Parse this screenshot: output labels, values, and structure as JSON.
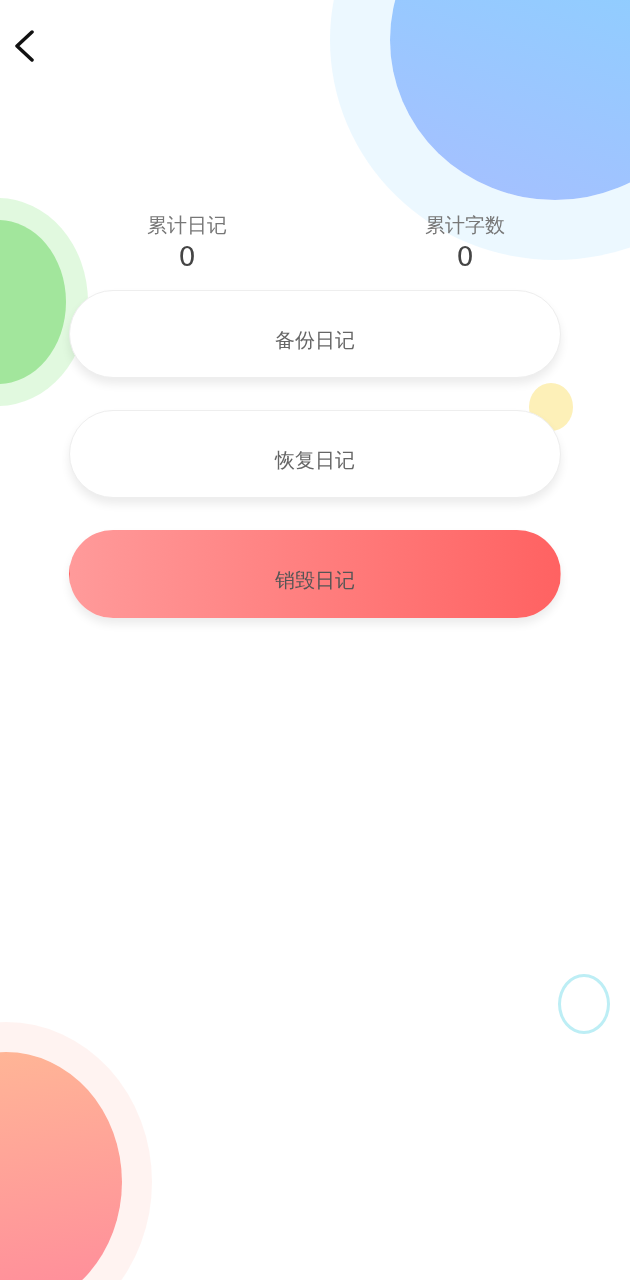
{
  "stats": [
    {
      "label": "累计日记",
      "value": "0"
    },
    {
      "label": "累计字数",
      "value": "0"
    }
  ],
  "buttons": [
    {
      "label": "备份日记",
      "kind": "plain"
    },
    {
      "label": "恢复日记",
      "kind": "plain"
    },
    {
      "label": "销毁日记",
      "kind": "danger"
    }
  ]
}
